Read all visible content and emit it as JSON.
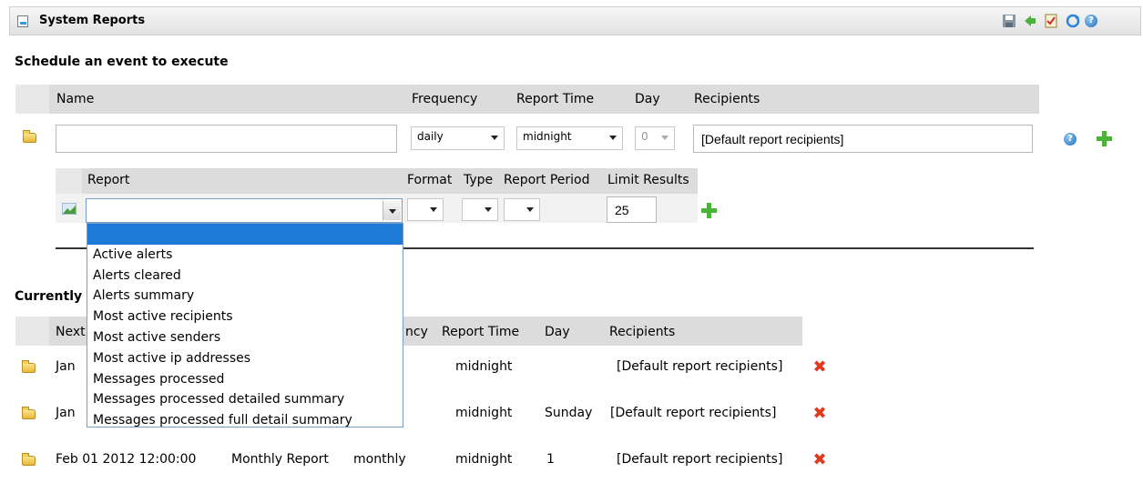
{
  "window": {
    "title": "System Reports",
    "toolbar_icons": [
      "save-icon",
      "run-icon",
      "checklist-icon",
      "refresh-icon",
      "help-icon"
    ]
  },
  "schedule": {
    "section_title": "Schedule an event to execute",
    "headers": {
      "name": "Name",
      "frequency": "Frequency",
      "report_time": "Report Time",
      "day": "Day",
      "recipients": "Recipients"
    },
    "name_value": "",
    "frequency_value": "daily",
    "report_time_value": "midnight",
    "day_value": "0",
    "recipients_value": "[Default report recipients]",
    "report_headers": {
      "report": "Report",
      "format": "Format",
      "type": "Type",
      "report_period": "Report Period",
      "limit_results": "Limit Results"
    },
    "report_value": "",
    "limit_results_value": "25",
    "report_options": [
      "",
      "Active alerts",
      "Alerts cleared",
      "Alerts summary",
      "Most active recipients",
      "Most active senders",
      "Most active ip addresses",
      "Messages processed",
      "Messages processed detailed summary",
      "Messages processed full detail summary"
    ]
  },
  "current": {
    "section_title": "Currently",
    "headers": {
      "next": "Next",
      "frequency": "ncy",
      "report_time": "Report Time",
      "day": "Day",
      "recipients": "Recipients"
    },
    "rows": [
      {
        "next": "Jan",
        "name": "",
        "frequency": "",
        "report_time": "midnight",
        "day": "",
        "recipients": "[Default report recipients]"
      },
      {
        "next": "Jan",
        "name": "",
        "frequency": "",
        "report_time": "midnight",
        "day": "Sunday",
        "recipients": "[Default report recipients]"
      },
      {
        "next": "Feb 01 2012 12:00:00",
        "name": "Monthly Report",
        "frequency": "monthly",
        "report_time": "midnight",
        "day": "1",
        "recipients": "[Default report recipients]"
      }
    ]
  },
  "colors": {
    "header_bg": "#dcdcdc",
    "selection": "#1e7ad7",
    "add": "#4cb33a",
    "delete": "#e03a1c"
  }
}
